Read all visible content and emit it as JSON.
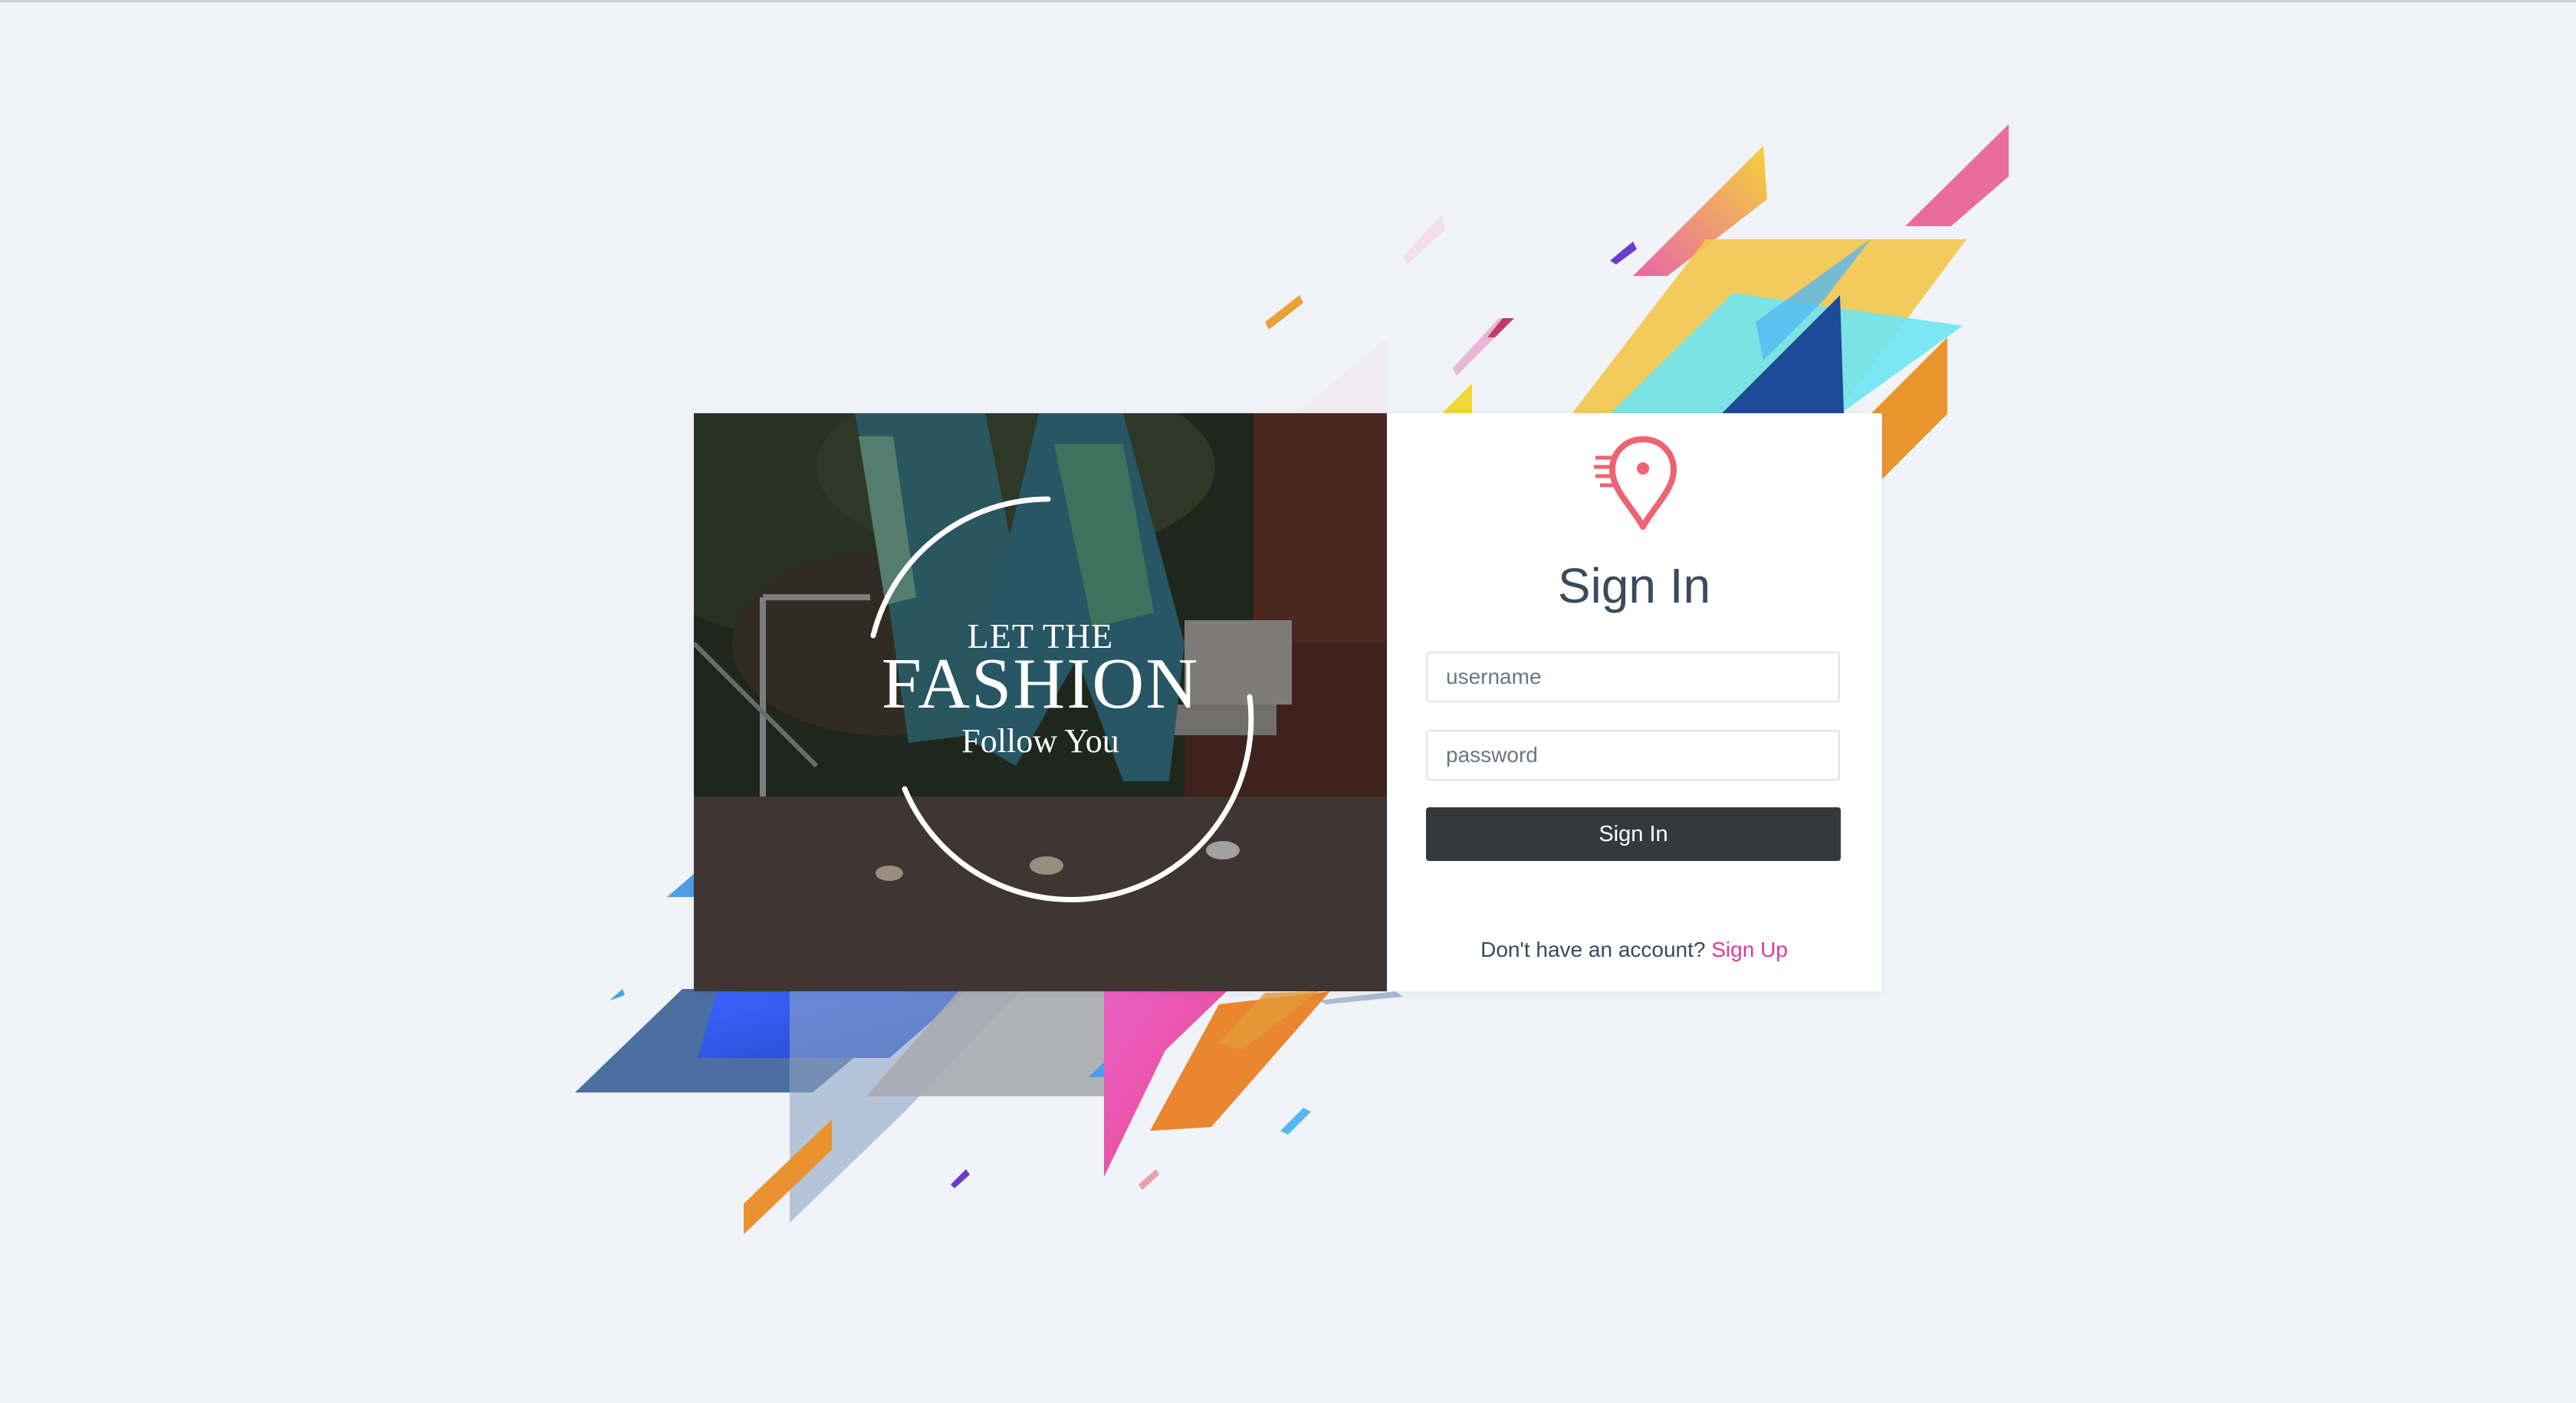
{
  "hero": {
    "line1": "LET THE",
    "line2": "FASHION",
    "line3": "Follow You"
  },
  "login": {
    "title": "Sign In",
    "username_placeholder": "username",
    "username_value": "",
    "password_placeholder": "password",
    "password_value": "",
    "submit_label": "Sign In",
    "footer_text": "Don't have an account?",
    "signup_label": "Sign Up"
  },
  "icons": {
    "logo": "location-pin-speed-icon"
  },
  "colors": {
    "background": "#f0f3f7",
    "title_text": "#3b4a5c",
    "button": "#34393f",
    "link": "#e0389a",
    "logo": "#ec6470"
  }
}
